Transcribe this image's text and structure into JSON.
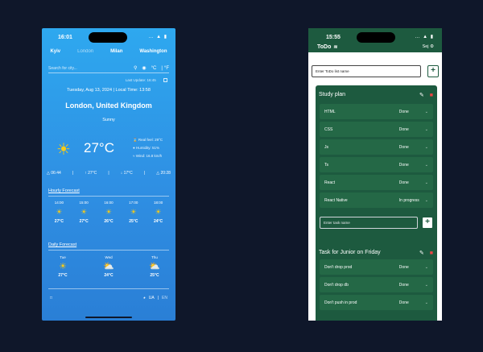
{
  "weather": {
    "status_time": "16:01",
    "status_icons": "… ▲ ▮",
    "tabs": [
      {
        "label": "Kyiv",
        "active": true
      },
      {
        "label": "London",
        "active": false
      },
      {
        "label": "Milan",
        "active": true
      },
      {
        "label": "Washington",
        "active": true
      }
    ],
    "search_placeholder": "Search for city...",
    "unit_c": "°C",
    "unit_f": "°F",
    "last_update": "Last Update:  16:45",
    "date_line": "Tuesday, Aug 13, 2024 | Local Time: 13:58",
    "city": "London, United Kingdom",
    "condition": "Sunny",
    "temperature": "27°C",
    "real_feel": "Real feel: 29°C",
    "humidity": "Humidity: 51%",
    "wind": "Wind: 16.8 km/h",
    "stats": [
      {
        "icon": "△",
        "value": "06:44"
      },
      {
        "icon": "↑",
        "value": "27°C"
      },
      {
        "icon": "↓",
        "value": "17°C"
      },
      {
        "icon": "△",
        "value": "20:28"
      }
    ],
    "hourly_label": "Hourly Forecast",
    "hourly": [
      {
        "time": "14:00",
        "temp": "27°C"
      },
      {
        "time": "15:00",
        "temp": "27°C"
      },
      {
        "time": "16:00",
        "temp": "26°C"
      },
      {
        "time": "17:00",
        "temp": "25°C"
      },
      {
        "time": "18:00",
        "temp": "24°C"
      }
    ],
    "daily_label": "Daily Forecast",
    "daily": [
      {
        "day": "Tue",
        "temp": "27°C",
        "icon": "☀"
      },
      {
        "day": "Wed",
        "temp": "24°C",
        "icon": "⛅"
      },
      {
        "day": "Thu",
        "temp": "25°C",
        "icon": "⛅"
      }
    ],
    "lang": "UA",
    "lang_alt": "EN",
    "colors": {
      "bg_top": "#2ea8ef",
      "bg_bottom": "#2a7fd6",
      "sun": "#facc15"
    }
  },
  "todo": {
    "status_time": "15:55",
    "status_icons": "… ▲ ▮",
    "app_title": "ToDo",
    "header_right": "Sej",
    "new_list_placeholder": "Enter ToDo list name",
    "lists": [
      {
        "title": "Study plan",
        "tasks": [
          {
            "name": "HTML",
            "status": "Done"
          },
          {
            "name": "CSS",
            "status": "Done"
          },
          {
            "name": "Js",
            "status": "Done"
          },
          {
            "name": "Ts",
            "status": "Done"
          },
          {
            "name": "React",
            "status": "Done"
          },
          {
            "name": "React Native",
            "status": "In progress"
          }
        ],
        "new_task_placeholder": "Enter task name"
      },
      {
        "title": "Task for Junior on Friday",
        "tasks": [
          {
            "name": "Don't drop prod",
            "status": "Done"
          },
          {
            "name": "Don't drop db",
            "status": "Done"
          },
          {
            "name": "Don't push in prod",
            "status": "Done"
          }
        ]
      }
    ],
    "colors": {
      "header": "#1d5a3f",
      "card": "#1d5a3f",
      "task": "#246846",
      "delete": "#ef4444"
    }
  }
}
